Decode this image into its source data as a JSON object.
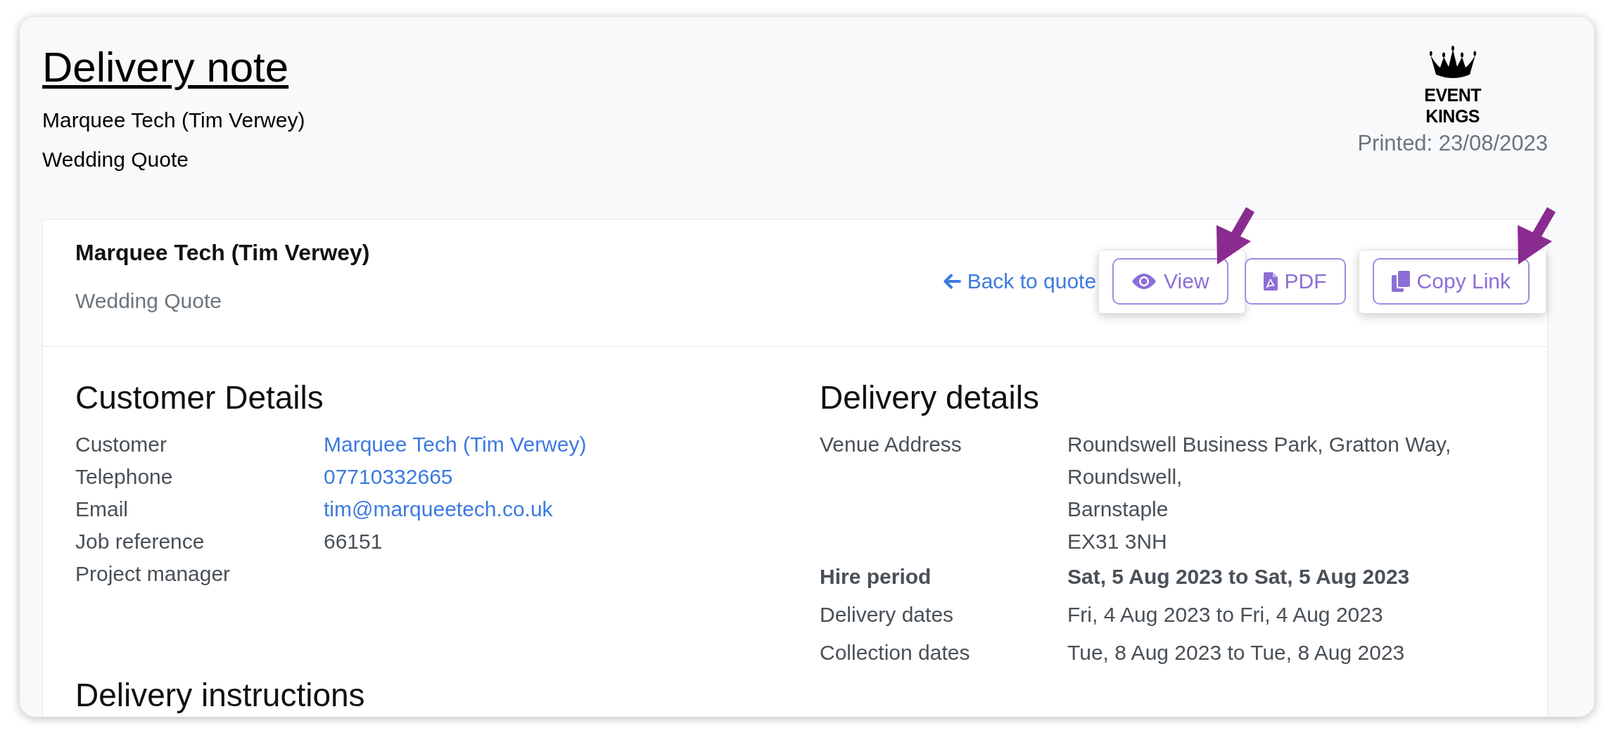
{
  "header": {
    "title": "Delivery note",
    "customer": "Marquee Tech (Tim Verwey)",
    "quote": "Wedding Quote",
    "logo_text": "EVENT KINGS",
    "printed": "Printed: 23/08/2023"
  },
  "card": {
    "title": "Marquee Tech (Tim Verwey)",
    "subtitle": "Wedding Quote",
    "back_link": "Back to quote",
    "buttons": [
      {
        "label": "View",
        "highlighted": true
      },
      {
        "label": "PDF",
        "highlighted": false
      },
      {
        "label": "Copy Link",
        "highlighted": true
      }
    ]
  },
  "customer_details": {
    "heading": "Customer Details",
    "rows": [
      {
        "label": "Customer",
        "value": "Marquee Tech (Tim Verwey)",
        "kind": "link"
      },
      {
        "label": "Telephone",
        "value": "07710332665",
        "kind": "link"
      },
      {
        "label": "Email",
        "value": "tim@marqueetech.co.uk",
        "kind": "link"
      },
      {
        "label": "Job reference",
        "value": "66151",
        "kind": "text"
      },
      {
        "label": "Project manager"
      }
    ]
  },
  "delivery_details": {
    "heading": "Delivery details",
    "rows": [
      {
        "label": "Venue Address",
        "lines": [
          "Roundswell Business Park, Gratton Way,",
          "Roundswell,",
          "Barnstaple",
          "EX31 3NH"
        ],
        "emphasized": false
      },
      {
        "label": "Hire period",
        "value": "Sat, 5 Aug 2023 to Sat, 5 Aug 2023",
        "emphasized": true
      },
      {
        "label": "Delivery dates",
        "value": "Fri, 4 Aug 2023 to Fri, 4 Aug 2023",
        "emphasized": false
      },
      {
        "label": "Collection dates",
        "value": "Tue, 8 Aug 2023 to Tue, 8 Aug 2023",
        "emphasized": false
      }
    ]
  },
  "delivery_instructions": {
    "heading": "Delivery instructions"
  }
}
